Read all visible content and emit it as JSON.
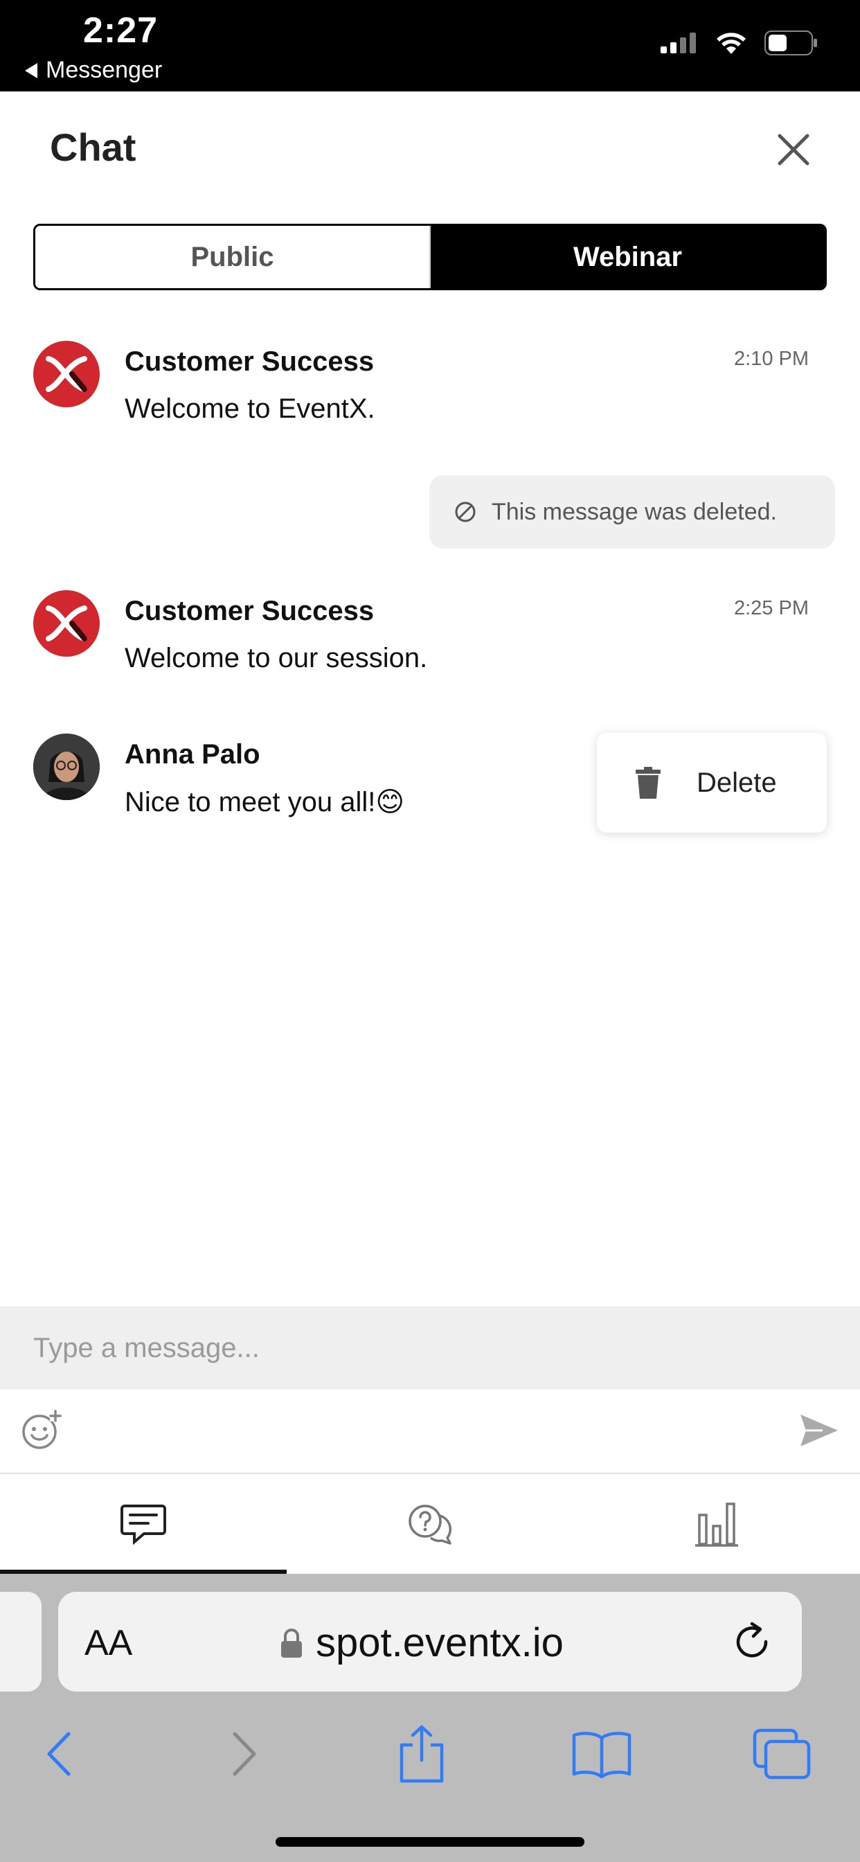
{
  "status_bar": {
    "time": "2:27",
    "back_app": "Messenger"
  },
  "header": {
    "title": "Chat"
  },
  "tabs": [
    {
      "label": "Public",
      "active": false
    },
    {
      "label": "Webinar",
      "active": true
    }
  ],
  "messages": [
    {
      "sender": "Customer Success",
      "text": "Welcome to EventX.",
      "time": "2:10 PM"
    },
    {
      "deleted_notice": "This message was deleted."
    },
    {
      "sender": "Customer Success",
      "text": "Welcome to our session.",
      "time": "2:25 PM"
    },
    {
      "sender": "Anna Palo",
      "text": "Nice to meet you all!😊"
    }
  ],
  "context_menu": {
    "delete_label": "Delete"
  },
  "composer": {
    "placeholder": "Type a message..."
  },
  "bottom_tabs": [
    {
      "icon": "chat-icon",
      "active": true
    },
    {
      "icon": "qa-icon",
      "active": false
    },
    {
      "icon": "poll-icon",
      "active": false
    }
  ],
  "browser": {
    "aa_label": "AA",
    "url": "spot.eventx.io"
  },
  "colors": {
    "brand_red": "#d0282e",
    "safari_blue": "#2f7cf6"
  }
}
